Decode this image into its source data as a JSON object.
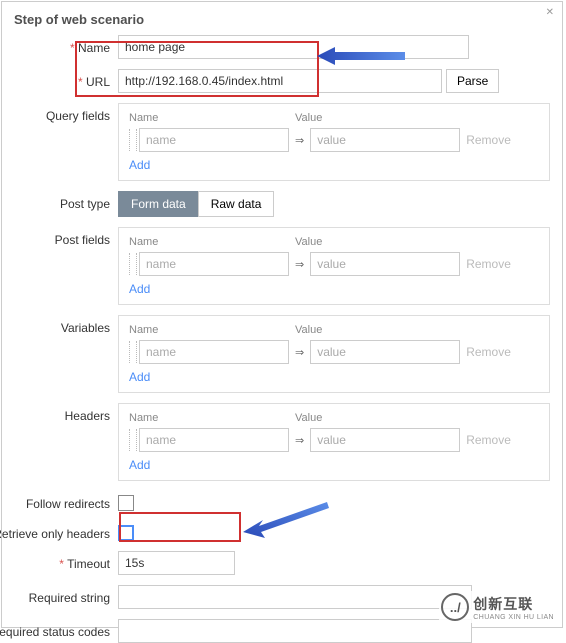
{
  "title": "Step of web scenario",
  "labels": {
    "name": "Name",
    "url": "URL",
    "query_fields": "Query fields",
    "post_type": "Post type",
    "post_fields": "Post fields",
    "variables": "Variables",
    "headers": "Headers",
    "follow_redirects": "Follow redirects",
    "retrieve_only_headers": "Retrieve only headers",
    "timeout": "Timeout",
    "required_string": "Required string",
    "required_status_codes": "Required status codes"
  },
  "values": {
    "name": "home page",
    "url": "http://192.168.0.45/index.html",
    "timeout": "15s",
    "required_string": "",
    "required_status_codes": ""
  },
  "buttons": {
    "parse": "Parse",
    "form_data": "Form data",
    "raw_data": "Raw data",
    "add": "Add",
    "remove": "Remove"
  },
  "panel": {
    "name_header": "Name",
    "value_header": "Value",
    "name_placeholder": "name",
    "value_placeholder": "value"
  },
  "watermark": {
    "main": "创新互联",
    "sub": "CHUANG XIN HU LIAN"
  }
}
